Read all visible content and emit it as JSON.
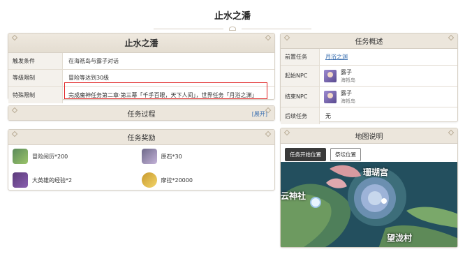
{
  "page": {
    "title": "止水之潘"
  },
  "task_panel": {
    "title": "止水之潘",
    "rows": [
      {
        "label": "触发条件",
        "value": "在海祇岛与露子对话"
      },
      {
        "label": "等级限制",
        "value": "冒险等达到30级"
      },
      {
        "label": "特殊限制",
        "value": "完成魔神任务第二章·第三幕「千手百眼，天下人间」，世界任务「月浴之渊」"
      }
    ]
  },
  "process_panel": {
    "title": "任务过程",
    "toggle": "[展开]"
  },
  "reward_panel": {
    "title": "任务奖励",
    "items": [
      {
        "label": "冒险阅历*200",
        "icon": "adventure-exp-icon"
      },
      {
        "label": "原石*30",
        "icon": "primogem-icon"
      },
      {
        "label": "大英雄的经验*2",
        "icon": "heros-wit-icon"
      },
      {
        "label": "摩拉*20000",
        "icon": "mora-icon"
      }
    ]
  },
  "overview_panel": {
    "title": "任务概述",
    "prev_label": "前置任务",
    "prev_value": "月浴之渊",
    "start_label": "起始NPC",
    "start_npc": {
      "name": "露子",
      "place": "海祇岛"
    },
    "end_label": "结束NPC",
    "end_npc": {
      "name": "露子",
      "place": "海祇岛"
    },
    "next_label": "后续任务",
    "next_value": "无"
  },
  "map_panel": {
    "title": "地图说明",
    "tabs": [
      "任务开始位置",
      "祭坛位置"
    ],
    "active_tab": 0,
    "labels": {
      "palace": "珊瑚宫",
      "shrine": "云神社",
      "village": "望泷村"
    }
  },
  "colors": {
    "accent_link": "#3a6fb0",
    "highlight": "#e02020",
    "panel_header": "#ece6dc"
  }
}
